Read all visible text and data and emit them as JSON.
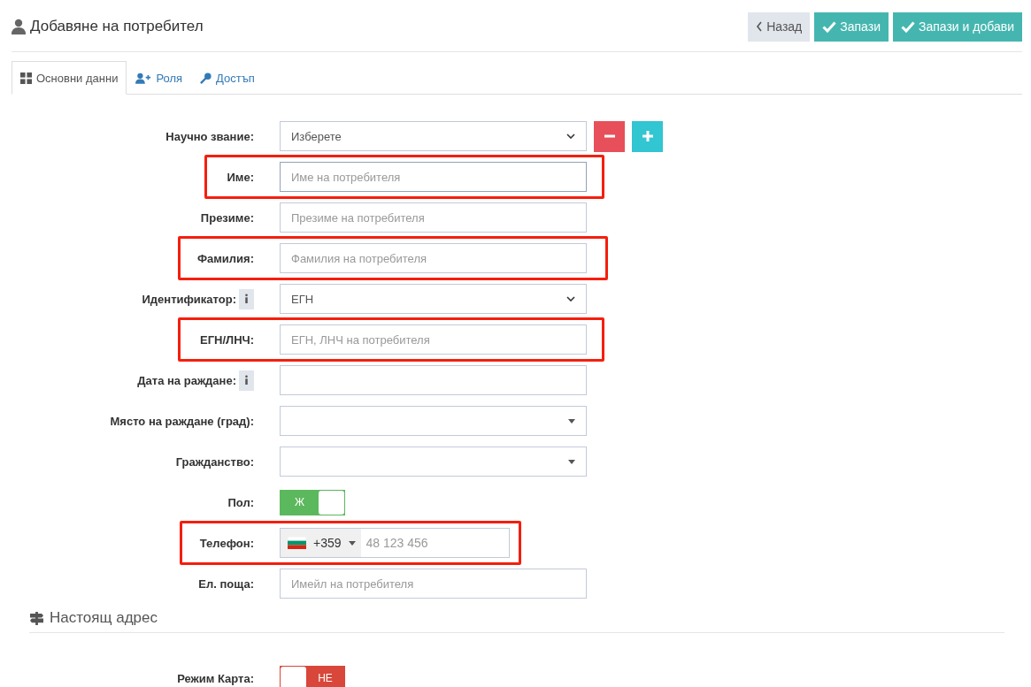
{
  "header": {
    "title": "Добавяне на потребител",
    "buttons": [
      {
        "kind": "back",
        "label": "Назад"
      },
      {
        "kind": "save",
        "label": "Запази"
      },
      {
        "kind": "save",
        "label": "Запази и добави"
      }
    ]
  },
  "tabs": [
    {
      "kind": "grid",
      "label": "Основни данни",
      "selected": true
    },
    {
      "kind": "user-plus",
      "label": "Роля",
      "selected": false
    },
    {
      "kind": "key",
      "label": "Достъп",
      "selected": false
    }
  ],
  "fields": [
    {
      "kind": "select",
      "label": "Научно звание:",
      "value": "Изберете",
      "highlighted": false,
      "actions": [
        {
          "kind": "minus"
        },
        {
          "kind": "plus"
        }
      ]
    },
    {
      "kind": "text",
      "label": "Име:",
      "placeholder": "Име на потребителя",
      "highlighted": true
    },
    {
      "kind": "text",
      "label": "Презиме:",
      "placeholder": "Презиме на потребителя",
      "highlighted": false
    },
    {
      "kind": "text",
      "label": "Фамилия:",
      "placeholder": "Фамилия на потребителя",
      "highlighted": true
    },
    {
      "kind": "select",
      "label": "Идентификатор:",
      "value": "ЕГН",
      "info": true,
      "highlighted": false
    },
    {
      "kind": "text",
      "label": "ЕГН/ЛНЧ:",
      "placeholder": "ЕГН, ЛНЧ на потребителя",
      "highlighted": true
    },
    {
      "kind": "text",
      "label": "Дата на раждане:",
      "info": true,
      "highlighted": false
    },
    {
      "kind": "dropdown",
      "label": "Място на раждане (град):",
      "highlighted": false
    },
    {
      "kind": "dropdown",
      "label": "Гражданство:",
      "highlighted": false
    },
    {
      "kind": "switch",
      "label": "Пол:",
      "on": true,
      "text": "Ж",
      "highlighted": false
    },
    {
      "kind": "phone",
      "label": "Телефон:",
      "code": "+359",
      "placeholder": "48 123 456",
      "highlighted": true
    },
    {
      "kind": "text",
      "label": "Ел. поща:",
      "placeholder": "Имейл на потребителя",
      "highlighted": false
    }
  ],
  "section": {
    "title": "Настоящ адрес"
  },
  "section_fields": [
    {
      "kind": "switch",
      "label": "Режим Карта:",
      "on": false,
      "text": "НЕ",
      "highlighted": false
    }
  ]
}
